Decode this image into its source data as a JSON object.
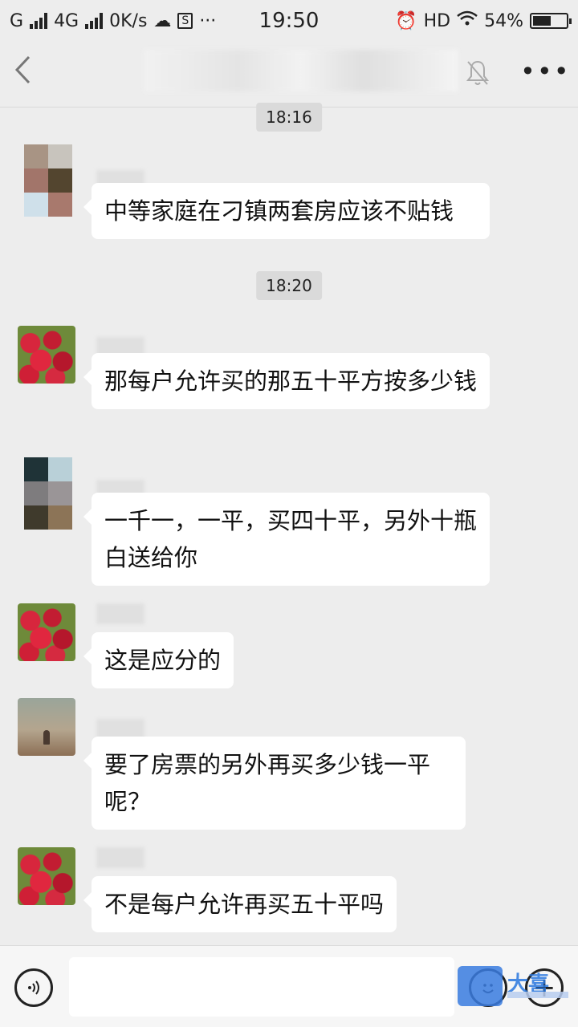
{
  "status_bar": {
    "carrier1": "G",
    "carrier2": "4G",
    "speed": "0K/s",
    "time": "19:50",
    "hd": "HD",
    "battery": "54%",
    "battery_level": 0.54
  },
  "navbar": {
    "back_icon": "chevron-left-icon",
    "mute_icon": "bell-muted-icon",
    "more_label": "•••"
  },
  "timestamps": [
    "18:16",
    "18:20"
  ],
  "messages": [
    {
      "avatar": "mosaic-avatar",
      "text": "中等家庭在刁镇两套房应该不贴钱"
    },
    {
      "avatar": "cherry-avatar",
      "text": "那每户允许买的那五十平方按多少钱"
    },
    {
      "avatar": "mosaic-avatar",
      "text": "一千一，一平，买四十平，另外十瓶白送给你"
    },
    {
      "avatar": "cherry-avatar",
      "text": "这是应分的"
    },
    {
      "avatar": "photo-avatar",
      "text": "要了房票的另外再买多少钱一平呢？"
    },
    {
      "avatar": "cherry-avatar",
      "text": "不是每户允许再买五十平吗"
    }
  ],
  "input_bar": {
    "voice_icon": "voice-icon",
    "emoji_icon": "emoji-icon",
    "plus_label": "+"
  },
  "watermark": {
    "text": "大喜"
  }
}
